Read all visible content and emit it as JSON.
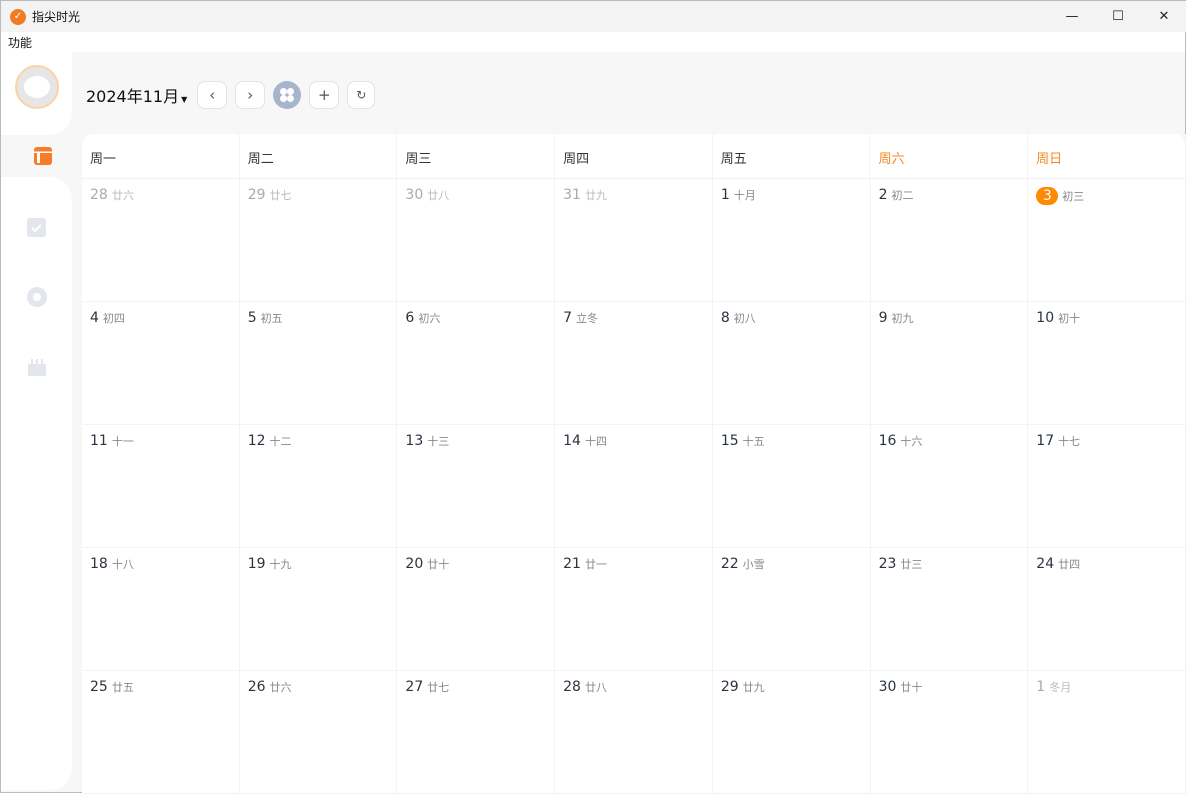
{
  "app": {
    "title": "指尖时光",
    "icon": "check-circle-icon"
  },
  "window": {
    "minimize": "—",
    "maximize": "☐",
    "close": "✕"
  },
  "menu": [
    "功能"
  ],
  "sidebar": {
    "items": [
      {
        "name": "calendar",
        "icon": "calendar-icon"
      },
      {
        "name": "tasks",
        "icon": "checkbox-icon"
      },
      {
        "name": "focus",
        "icon": "circle-icon"
      },
      {
        "name": "anniversary",
        "icon": "cake-icon"
      }
    ]
  },
  "toolbar": {
    "month": "2024年11月",
    "prev": "‹",
    "next": "›",
    "add": "+",
    "refresh": "↻"
  },
  "colors": {
    "accent": "#ff8a00",
    "weekend": "#f5891f"
  },
  "weekdays": [
    "周一",
    "周二",
    "周三",
    "周四",
    "周五",
    "周六",
    "周日"
  ],
  "days": [
    {
      "d": "28",
      "l": "廿六",
      "o": true
    },
    {
      "d": "29",
      "l": "廿七",
      "o": true
    },
    {
      "d": "30",
      "l": "廿八",
      "o": true
    },
    {
      "d": "31",
      "l": "廿九",
      "o": true
    },
    {
      "d": "1",
      "l": "十月"
    },
    {
      "d": "2",
      "l": "初二"
    },
    {
      "d": "3",
      "l": "初三",
      "t": true
    },
    {
      "d": "4",
      "l": "初四"
    },
    {
      "d": "5",
      "l": "初五"
    },
    {
      "d": "6",
      "l": "初六"
    },
    {
      "d": "7",
      "l": "立冬"
    },
    {
      "d": "8",
      "l": "初八"
    },
    {
      "d": "9",
      "l": "初九"
    },
    {
      "d": "10",
      "l": "初十"
    },
    {
      "d": "11",
      "l": "十一"
    },
    {
      "d": "12",
      "l": "十二"
    },
    {
      "d": "13",
      "l": "十三"
    },
    {
      "d": "14",
      "l": "十四"
    },
    {
      "d": "15",
      "l": "十五"
    },
    {
      "d": "16",
      "l": "十六"
    },
    {
      "d": "17",
      "l": "十七"
    },
    {
      "d": "18",
      "l": "十八"
    },
    {
      "d": "19",
      "l": "十九"
    },
    {
      "d": "20",
      "l": "廿十"
    },
    {
      "d": "21",
      "l": "廿一"
    },
    {
      "d": "22",
      "l": "小雪"
    },
    {
      "d": "23",
      "l": "廿三"
    },
    {
      "d": "24",
      "l": "廿四"
    },
    {
      "d": "25",
      "l": "廿五"
    },
    {
      "d": "26",
      "l": "廿六"
    },
    {
      "d": "27",
      "l": "廿七"
    },
    {
      "d": "28",
      "l": "廿八"
    },
    {
      "d": "29",
      "l": "廿九"
    },
    {
      "d": "30",
      "l": "廿十"
    },
    {
      "d": "1",
      "l": "冬月",
      "o": true
    }
  ]
}
